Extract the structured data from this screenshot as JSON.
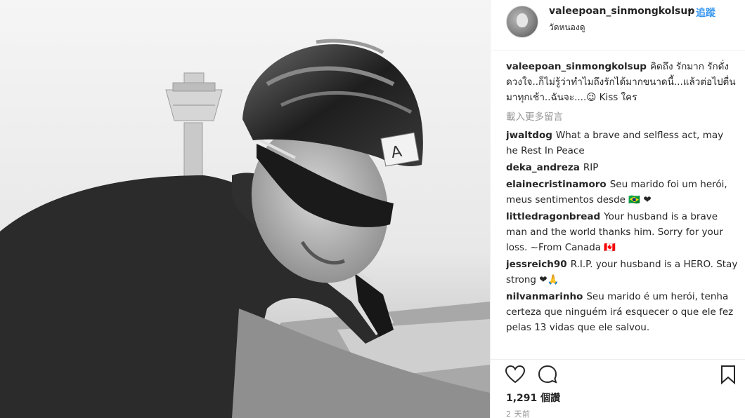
{
  "post": {
    "username": "valeepoan_sinmongkolsup",
    "separator": "•",
    "follow_label": "追蹤",
    "location": "วัดหนองดู"
  },
  "caption": {
    "username": "valeepoan_sinmongkolsup",
    "text": "คิดถึง รักมาก รักดั่งดวงใจ..ก็ไม่รู้ว่าทำไมถึงรักได้มากขนาดนี้...แล้วต่อไปตื่นมาทุกเช้า..ฉันจะ....😉 Kiss ใคร"
  },
  "load_more_label": "載入更多留言",
  "comments": [
    {
      "username": "jwaltdog",
      "text": "What a brave and selfless act, may he Rest In Peace"
    },
    {
      "username": "deka_andreza",
      "text": "RIP"
    },
    {
      "username": "elainecristinamoro",
      "text": "Seu marido foi um herói, meus sentimentos desde 🇧🇷 ❤"
    },
    {
      "username": "littledragonbread",
      "text": "Your husband is a brave man and the world thanks him. Sorry for your loss. ~From Canada 🇨🇦"
    },
    {
      "username": "jessreich90",
      "text": "R.I.P. your husband is a HERO. Stay strong ❤🙏"
    },
    {
      "username": "nilvanmarinho",
      "text": "Seu marido é um herói, tenha certeza que ninguém irá esquecer o que ele fez pelas 13 vidas que ele salvou."
    }
  ],
  "stats": {
    "likes_text": "1,291 個讚",
    "time_text": "2 天前"
  },
  "icons": {
    "like": "heart-icon",
    "comment": "comment-icon",
    "save": "bookmark-icon"
  },
  "colors": {
    "link": "#3897f0",
    "text": "#262626",
    "muted": "#999999"
  }
}
